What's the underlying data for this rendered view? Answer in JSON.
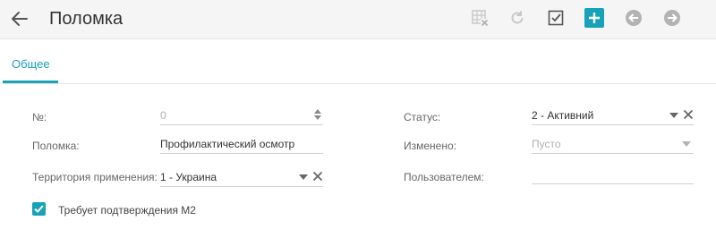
{
  "header": {
    "title": "Поломка",
    "icons": [
      "back-arrow-icon",
      "table-delete-icon",
      "refresh-icon",
      "checkbox-confirm-icon",
      "add-icon",
      "previous-icon",
      "next-icon"
    ]
  },
  "tabs": [
    {
      "label": "Общее",
      "active": true
    }
  ],
  "form": {
    "number": {
      "label": "№:",
      "value": "0"
    },
    "breakdown": {
      "label": "Поломка:",
      "value": "Профилактический осмотр"
    },
    "territory": {
      "label": "Территория применения:",
      "value": "1 - Украина"
    },
    "status": {
      "label": "Статус:",
      "value": "2 - Активний"
    },
    "changed": {
      "label": "Изменено:",
      "placeholder": "Пусто"
    },
    "user": {
      "label": "Пользователем:",
      "value": ""
    },
    "requires_confirmation": {
      "label": "Требует подтверждения М2",
      "checked": true
    }
  },
  "colors": {
    "accent": "#17a2b8",
    "header_bg": "#f5f5f5",
    "disabled_icon": "#c8c8c8",
    "nav_icon": "#b3b3b3"
  }
}
